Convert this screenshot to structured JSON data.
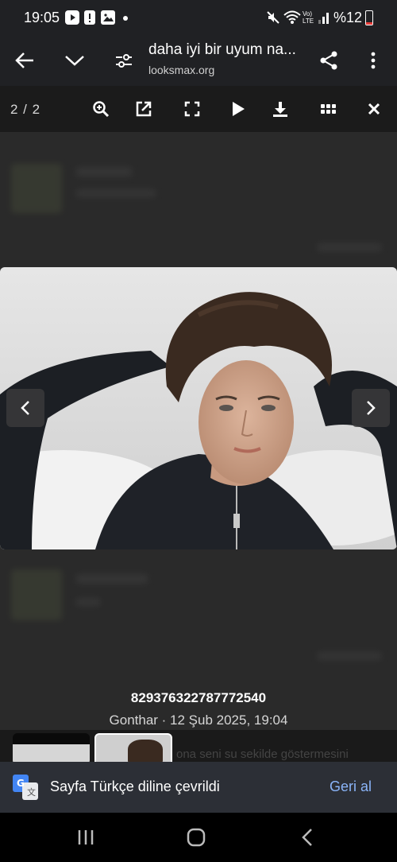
{
  "status_bar": {
    "time": "19:05",
    "battery": "%12"
  },
  "browser": {
    "page_title": "daha iyi bir uyum na...",
    "url": "looksmax.org"
  },
  "lightbox": {
    "counter": "2 / 2",
    "caption_title": "829376322787772540",
    "caption_meta": "Gonthar · 12 Şub 2025, 19:04"
  },
  "background_text": "ona seni su sekilde göstermesini",
  "translate_banner": {
    "message": "Sayfa Türkçe diline çevrildi",
    "undo_label": "Geri al"
  },
  "colors": {
    "toolbar_bg": "#202124",
    "banner_bg": "#2c2f36",
    "accent_link": "#8ab4f8"
  }
}
